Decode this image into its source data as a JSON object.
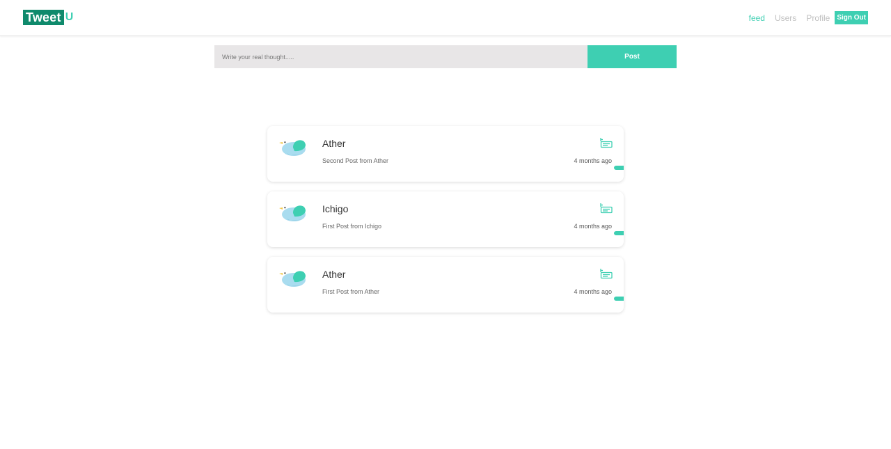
{
  "brand": {
    "name_main": "Tweet",
    "name_accent": "U",
    "primary_color": "#0f8a6c",
    "accent_color": "#3ecfb2"
  },
  "nav": {
    "feed": "feed",
    "users": "Users",
    "profile": "Profile",
    "signout": "Sign Out",
    "active": "feed"
  },
  "composer": {
    "placeholder": "Write your real thought.....",
    "value": "",
    "post_label": "Post"
  },
  "posts": [
    {
      "author": "Ather",
      "content": "Second Post from Ather",
      "time": "4 months ago",
      "avatar_icon": "bird-icon",
      "action_icon": "detail-icon"
    },
    {
      "author": "Ichigo",
      "content": "First Post from Ichigo",
      "time": "4 months ago",
      "avatar_icon": "bird-icon",
      "action_icon": "detail-icon"
    },
    {
      "author": "Ather",
      "content": "First Post from Ather",
      "time": "4 months ago",
      "avatar_icon": "bird-icon",
      "action_icon": "detail-icon"
    }
  ]
}
